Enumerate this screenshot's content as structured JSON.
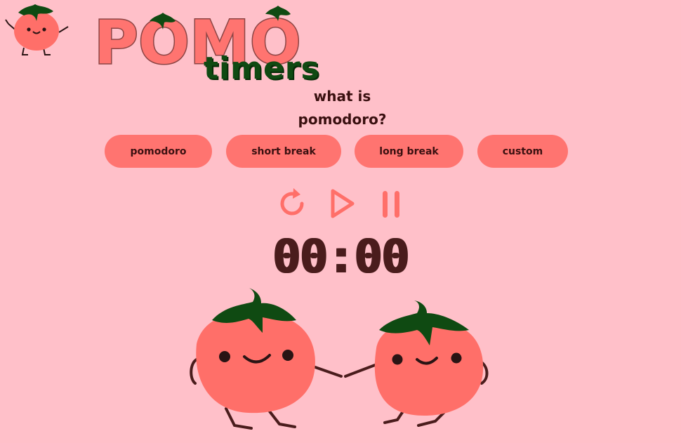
{
  "logo": {
    "title": "POMO",
    "subtitle": "timers"
  },
  "nav": {
    "what_is_line1": "what is",
    "what_is_line2": "pomodoro?"
  },
  "modes": [
    {
      "label": "pomodoro"
    },
    {
      "label": "short break"
    },
    {
      "label": "long break"
    },
    {
      "label": "custom"
    }
  ],
  "controls": {
    "restart_icon": "restart-icon",
    "play_icon": "play-icon",
    "pause_icon": "pause-icon"
  },
  "timer": {
    "display": "00:00"
  },
  "colors": {
    "background": "#ffc0c9",
    "accent": "#ff7470",
    "leaf": "#0f4a12",
    "text": "#3a1010",
    "timer": "#4a1c1c"
  }
}
